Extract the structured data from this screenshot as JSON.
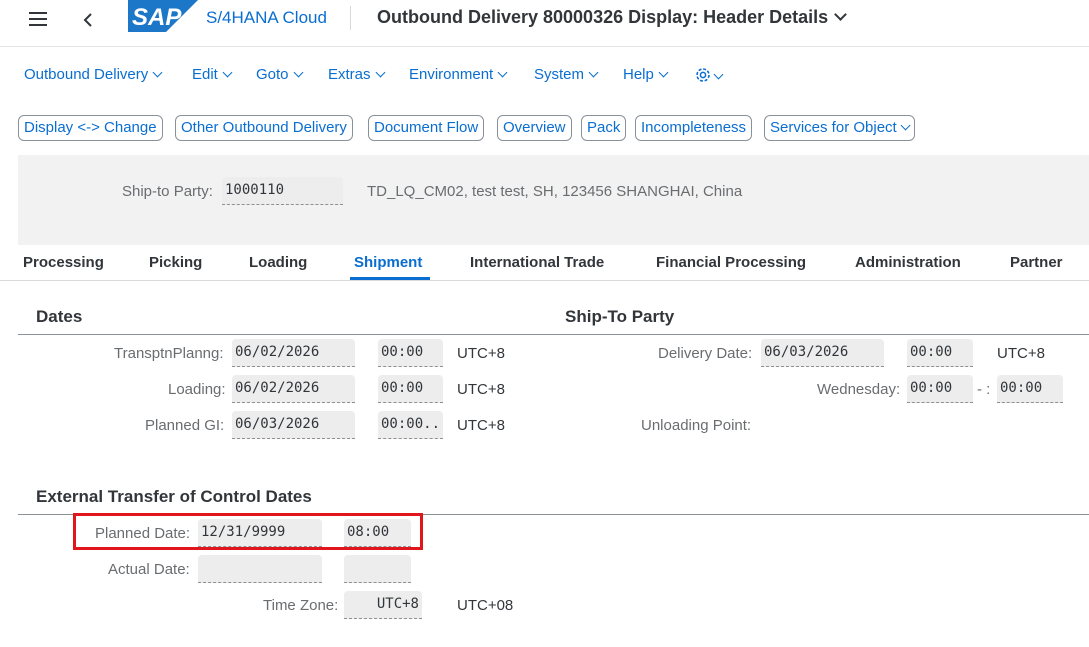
{
  "shell": {
    "product": "S/4HANA Cloud",
    "title": "Outbound Delivery 80000326 Display: Header Details",
    "logo_text": "SAP",
    "brand_color": "#0a6ed1"
  },
  "menu": [
    "Outbound Delivery",
    "Edit",
    "Goto",
    "Extras",
    "Environment",
    "System",
    "Help"
  ],
  "toolbar": [
    "Display <-> Change",
    "Other Outbound Delivery",
    "Document Flow",
    "Overview",
    "Pack",
    "Incompleteness",
    "Services for Object"
  ],
  "header": {
    "ship_to_label": "Ship-to Party:",
    "ship_to_value": "1000110",
    "ship_to_desc": "TD_LQ_CM02, test test, SH, 123456 SHANGHAI, China"
  },
  "tabs": [
    "Processing",
    "Picking",
    "Loading",
    "Shipment",
    "International Trade",
    "Financial Processing",
    "Administration",
    "Partner"
  ],
  "active_tab": "Shipment",
  "dates": {
    "title": "Dates",
    "rows": [
      {
        "label": "TransptnPlanng:",
        "date": "06/02/2026",
        "time": "00:00",
        "tz": "UTC+8"
      },
      {
        "label": "Loading:",
        "date": "06/02/2026",
        "time": "00:00",
        "tz": "UTC+8"
      },
      {
        "label": "Planned GI:",
        "date": "06/03/2026",
        "time": "00:00...",
        "tz": "UTC+8"
      }
    ]
  },
  "ship_to_party": {
    "title": "Ship-To Party",
    "delivery_date_label": "Delivery Date:",
    "delivery_date": "06/03/2026",
    "delivery_time": "00:00",
    "delivery_tz": "UTC+8",
    "weekday_label": "Wednesday:",
    "weekday_from": "00:00",
    "weekday_sep": "- :",
    "weekday_to": "00:00",
    "unloading_label": "Unloading Point:"
  },
  "transfer": {
    "title": "External Transfer of Control Dates",
    "planned_label": "Planned Date:",
    "planned_date": "12/31/9999",
    "planned_time": "08:00",
    "actual_label": "Actual Date:",
    "actual_date": "",
    "actual_time": "",
    "tz_label": "Time Zone:",
    "tz_value": "UTC+8",
    "tz_desc": "UTC+08"
  },
  "highlight_color": "#e0161c"
}
